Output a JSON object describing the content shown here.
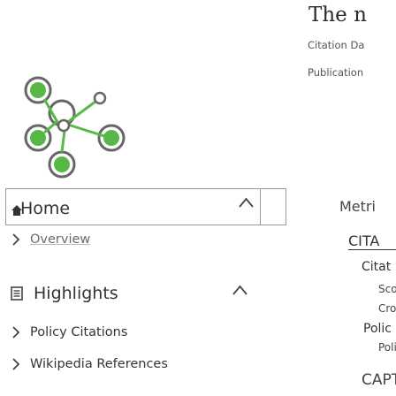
{
  "header": {
    "title_partial": "The n",
    "citation_database_partial": "Citation Da",
    "publication_partial": "Publication"
  },
  "nav": {
    "home_label": "Home",
    "overview_label": "Overview",
    "highlights_label": "Highlights",
    "policy_citations_label": "Policy Citations",
    "wikipedia_references_label": "Wikipedia References"
  },
  "right_panel": {
    "metrics_partial": "Metri",
    "cita_partial": "CITA",
    "citat_partial": "Citat",
    "scop_partial": "Sco",
    "cro_partial": "Cro",
    "polic_partial": "Polic",
    "poli_partial": "Poli",
    "capt_partial": "CAPT"
  },
  "colors": {
    "logo_green": "#57b847",
    "logo_outline": "#666666",
    "border": "#9a9a9a"
  },
  "icons": {
    "logo": "altmetric-style-logo",
    "home": "home-icon",
    "chevron": "chevron-right-icon",
    "collapse": "chevron-up-icon",
    "document": "document-icon"
  }
}
